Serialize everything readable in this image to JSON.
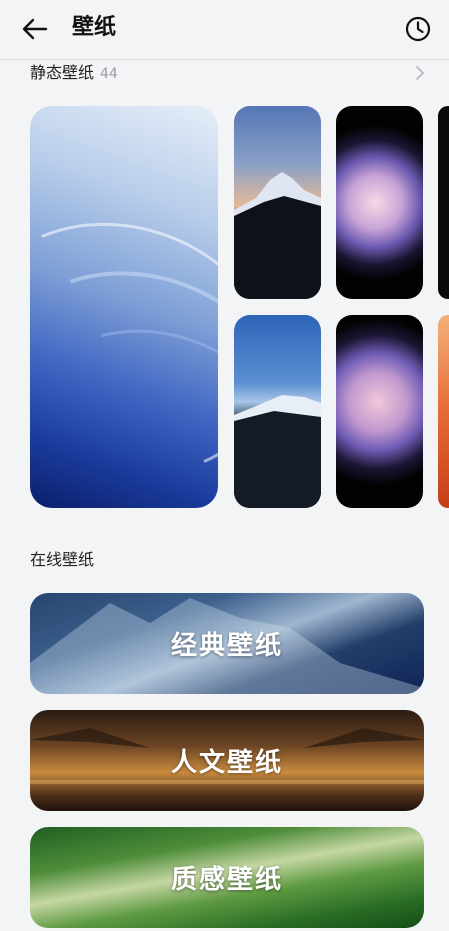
{
  "header": {
    "title": "壁纸",
    "back_icon": "arrow-left-icon",
    "history_icon": "clock-icon"
  },
  "static_section": {
    "label": "静态壁纸",
    "count": "44",
    "more_icon": "chevron-right-icon",
    "thumbnails": [
      {
        "name": "blue-abstract-waves"
      },
      {
        "name": "mountain-dusk"
      },
      {
        "name": "mountain-blue-sky"
      },
      {
        "name": "pink-flower-dark"
      },
      {
        "name": "purple-flower-dark"
      }
    ]
  },
  "online_section": {
    "label": "在线壁纸",
    "categories": [
      {
        "label": "经典壁纸"
      },
      {
        "label": "人文壁纸"
      },
      {
        "label": "质感壁纸"
      }
    ]
  },
  "colors": {
    "background": "#f3f4f6",
    "text": "#111111",
    "secondary_text": "#9a9da3"
  }
}
